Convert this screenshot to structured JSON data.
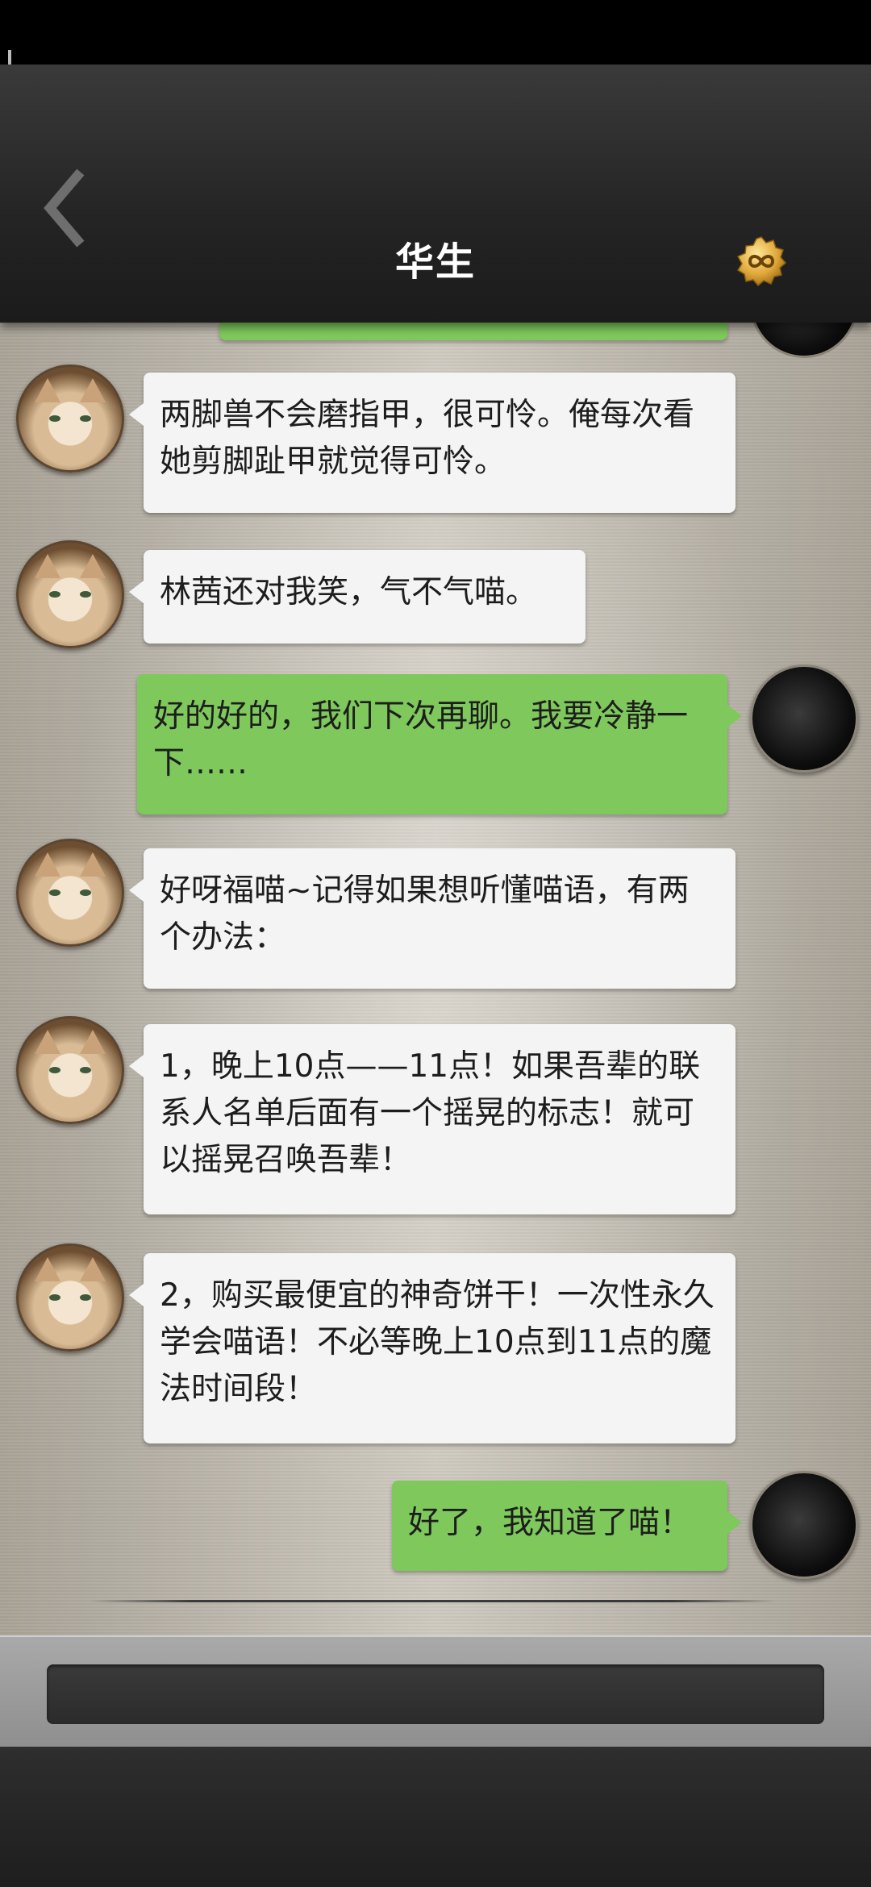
{
  "header": {
    "title": "华生"
  },
  "icons": {
    "back": "chevron-left-icon",
    "coin": "gold-coin-infinity-icon"
  },
  "colors": {
    "incoming_bubble": "#f4f4f4",
    "outgoing_bubble": "#7ec85c",
    "header": "#242424"
  },
  "messages": [
    {
      "from": "cat",
      "text": "两脚兽不会磨指甲，很可怜。俺每次看她剪脚趾甲就觉得可怜。"
    },
    {
      "from": "cat",
      "text": "林茜还对我笑，气不气喵。"
    },
    {
      "from": "me",
      "text": "好的好的，我们下次再聊。我要冷静一下……"
    },
    {
      "from": "cat",
      "text": "好呀福喵~记得如果想听懂喵语，有两个办法："
    },
    {
      "from": "cat",
      "text": "1，晚上10点——11点！如果吾辈的联系人名单后面有一个摇晃的标志！就可以摇晃召唤吾辈！"
    },
    {
      "from": "cat",
      "text": "2，购买最便宜的神奇饼干！一次性永久学会喵语！不必等晚上10点到11点的魔法时间段！"
    },
    {
      "from": "me",
      "text": "好了，我知道了喵！"
    }
  ],
  "input": {
    "value": "",
    "placeholder": ""
  }
}
